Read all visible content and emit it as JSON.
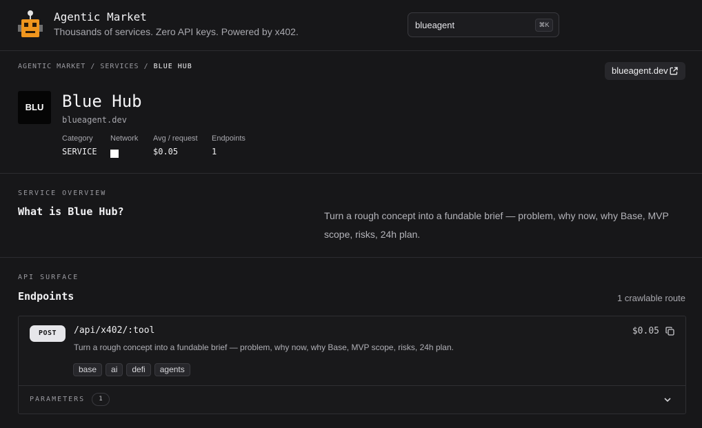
{
  "header": {
    "title": "Agentic Market",
    "subtitle": "Thousands of services. Zero API keys. Powered by x402.",
    "search_value": "blueagent",
    "shortcut": "⌘K"
  },
  "breadcrumb": {
    "items": [
      "AGENTIC MARKET",
      "SERVICES"
    ],
    "separator": "/",
    "current": "BLUE HUB"
  },
  "site_button": {
    "label": "blueagent.dev",
    "icon": "external-link-icon"
  },
  "service": {
    "badge": "BLU",
    "name": "Blue Hub",
    "domain": "blueagent.dev",
    "meta": {
      "category_label": "Category",
      "category_value": "SERVICE",
      "network_label": "Network",
      "avg_label": "Avg / request",
      "avg_value": "$0.05",
      "endpoints_label": "Endpoints",
      "endpoints_value": "1"
    }
  },
  "overview": {
    "kicker": "SERVICE OVERVIEW",
    "heading": "What is Blue Hub?",
    "text": "Turn a rough concept into a fundable brief — problem, why now, why Base, MVP scope, risks, 24h plan."
  },
  "api": {
    "kicker": "API SURFACE",
    "heading": "Endpoints",
    "route_count": "1 crawlable route",
    "endpoint": {
      "method": "POST",
      "path": "/api/x402/:tool",
      "price": "$0.05",
      "description": "Turn a rough concept into a fundable brief — problem, why now, why Base, MVP scope, risks, 24h plan.",
      "tags": [
        "base",
        "ai",
        "defi",
        "agents"
      ],
      "params_label": "PARAMETERS",
      "params_count": "1"
    }
  },
  "colors": {
    "background": "#171719",
    "logo_orange": "#f0961e",
    "method_badge": "#e6e6ea",
    "network_square": "#ffffff"
  }
}
